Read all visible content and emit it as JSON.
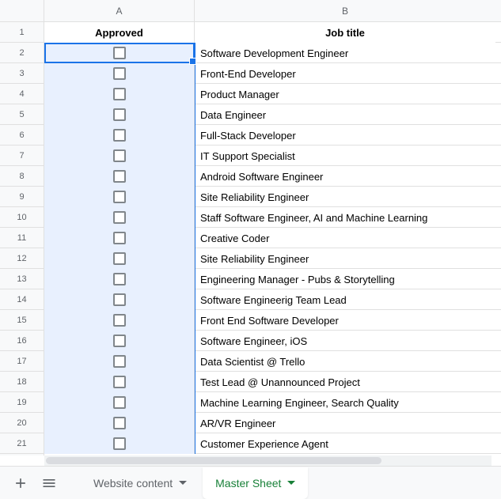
{
  "columns": {
    "a": "A",
    "b": "B"
  },
  "headers": {
    "approved": "Approved",
    "jobtitle": "Job title"
  },
  "rows": [
    {
      "num": "1"
    },
    {
      "num": "2",
      "title": "Software Development Engineer"
    },
    {
      "num": "3",
      "title": "Front-End Developer"
    },
    {
      "num": "4",
      "title": "Product Manager"
    },
    {
      "num": "5",
      "title": "Data Engineer"
    },
    {
      "num": "6",
      "title": "Full-Stack Developer"
    },
    {
      "num": "7",
      "title": "IT Support Specialist"
    },
    {
      "num": "8",
      "title": "Android Software Engineer"
    },
    {
      "num": "9",
      "title": "Site Reliability Engineer"
    },
    {
      "num": "10",
      "title": "Staff Software Engineer, AI and Machine Learning"
    },
    {
      "num": "11",
      "title": "Creative Coder"
    },
    {
      "num": "12",
      "title": "Site Reliability Engineer"
    },
    {
      "num": "13",
      "title": "Engineering Manager - Pubs & Storytelling"
    },
    {
      "num": "14",
      "title": "Software Engineerig Team Lead"
    },
    {
      "num": "15",
      "title": "Front End Software Developer"
    },
    {
      "num": "16",
      "title": "Software Engineer, iOS"
    },
    {
      "num": "17",
      "title": "Data Scientist @ Trello"
    },
    {
      "num": "18",
      "title": "Test Lead @ Unannounced Project"
    },
    {
      "num": "19",
      "title": "Machine Learning Engineer, Search Quality"
    },
    {
      "num": "20",
      "title": "AR/VR Engineer"
    },
    {
      "num": "21",
      "title": "Customer Experience Agent"
    }
  ],
  "tabs": {
    "website": "Website content",
    "master": "Master Sheet"
  }
}
